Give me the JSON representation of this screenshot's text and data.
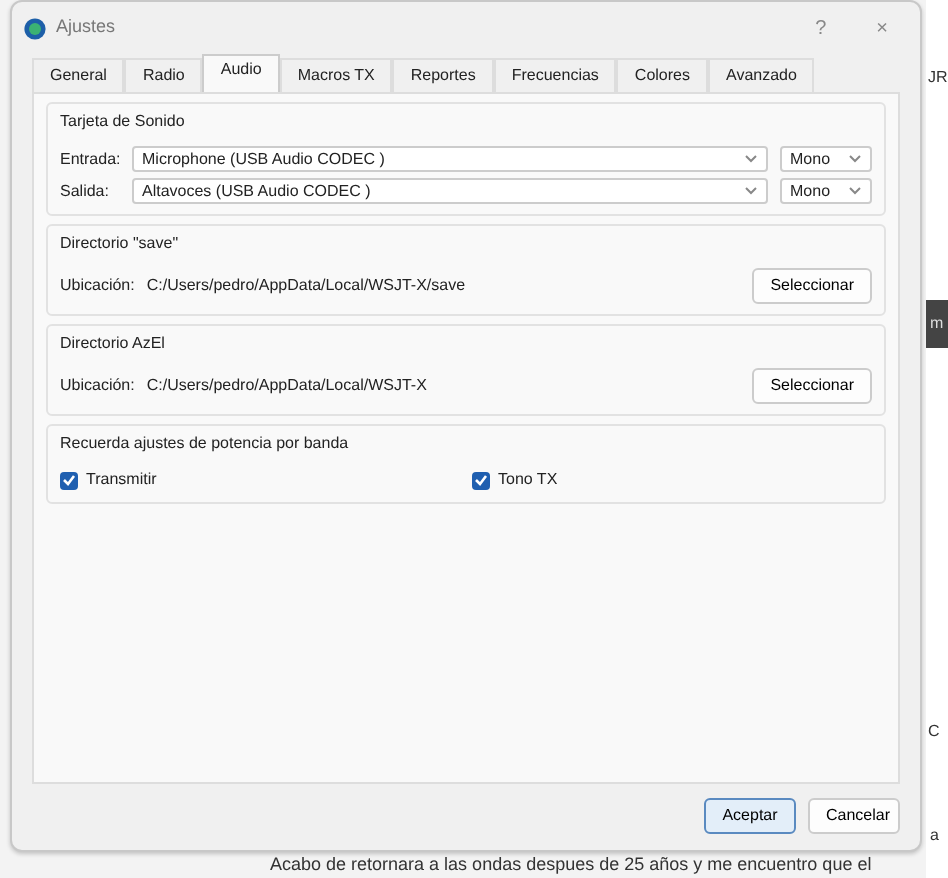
{
  "background": {
    "fragments": [
      {
        "text": "JR",
        "kind": "plain"
      },
      {
        "text": "m",
        "kind": "dark"
      },
      {
        "text": "C",
        "kind": "plain"
      },
      {
        "text": "a",
        "kind": "plain"
      }
    ],
    "post_text": "Acabo de retornara a las ondas despues de 25 años y me encuentro que el"
  },
  "window": {
    "title": "Ajustes",
    "help": "?",
    "close": "×"
  },
  "tabs": [
    {
      "label": "General",
      "selected": false
    },
    {
      "label": "Radio",
      "selected": false
    },
    {
      "label": "Audio",
      "selected": true
    },
    {
      "label": "Macros TX",
      "selected": false
    },
    {
      "label": "Reportes",
      "selected": false
    },
    {
      "label": "Frecuencias",
      "selected": false
    },
    {
      "label": "Colores",
      "selected": false
    },
    {
      "label": "Avanzado",
      "selected": false
    }
  ],
  "groups": [
    {
      "kind": "devices",
      "title": "Tarjeta de Sonido",
      "rows": [
        {
          "label": "Entrada:",
          "device": "Microphone (USB Audio CODEC )",
          "channel": "Mono"
        },
        {
          "label": "Salida:",
          "device": "Altavoces (USB Audio CODEC )",
          "channel": "Mono"
        }
      ]
    },
    {
      "kind": "path",
      "title": "Directorio \"save\"",
      "label": "Ubicación:",
      "path": "C:/Users/pedro/AppData/Local/WSJT-X/save",
      "button": "Seleccionar"
    },
    {
      "kind": "path",
      "title": "Directorio AzEl",
      "label": "Ubicación:",
      "path": "C:/Users/pedro/AppData/Local/WSJT-X",
      "button": "Seleccionar"
    },
    {
      "kind": "checks",
      "title": "Recuerda ajustes de potencia por banda",
      "items": [
        {
          "label": "Transmitir",
          "checked": true
        },
        {
          "label": "Tono TX",
          "checked": true
        }
      ]
    }
  ],
  "buttons": [
    {
      "label": "Aceptar",
      "default": true
    },
    {
      "label": "Cancelar",
      "default": false
    }
  ]
}
